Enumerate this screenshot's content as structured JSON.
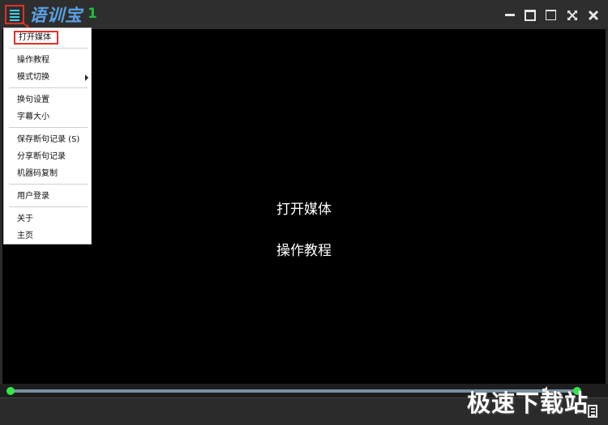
{
  "app": {
    "title": "语训宝",
    "version": "1"
  },
  "icons": {
    "menu": "hamburger-menu-icon",
    "minimize": "minimize-icon",
    "restore": "restore-icon",
    "maximize": "maximize-icon",
    "fullscreen": "fullscreen-icon",
    "close": "close-icon",
    "volume": "volume-icon",
    "playlist": "playlist-icon"
  },
  "colors": {
    "accent_cyan": "#3fd2ea",
    "title_blue": "#5aa0e4",
    "version_green": "#1cbf3c",
    "highlight_red": "#e0302a",
    "slider_green": "#34e84a"
  },
  "menu": {
    "items": [
      {
        "label": "打开媒体",
        "highlighted": true
      },
      {
        "label": "操作教程"
      },
      {
        "label": "模式切换",
        "submenu": true
      },
      {
        "label": "换句设置"
      },
      {
        "label": "字幕大小"
      },
      {
        "label": "保存断句记录 (S)"
      },
      {
        "label": "分享断句记录"
      },
      {
        "label": "机器码复制"
      },
      {
        "label": "用户登录"
      },
      {
        "label": "关于"
      },
      {
        "label": "主页"
      }
    ]
  },
  "main": {
    "open_media": "打开媒体",
    "tutorial": "操作教程"
  },
  "playback": {
    "progress": 0,
    "volume": 1
  },
  "watermark": "极速下载站"
}
